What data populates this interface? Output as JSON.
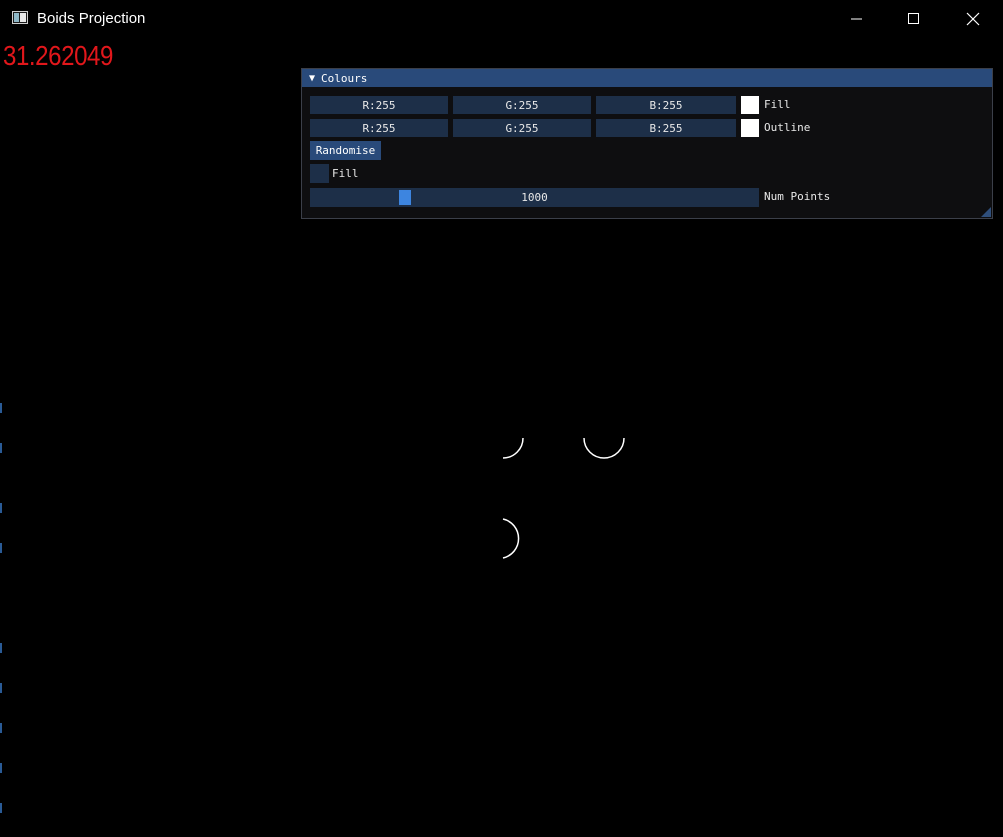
{
  "window": {
    "title": "Boids Projection",
    "icons": {
      "app": "app-window-icon",
      "minimize": "minimize-icon",
      "maximize": "maximize-icon",
      "close": "close-icon"
    }
  },
  "overlay": {
    "fps_value": "31.262049",
    "fps_color": "#e1171b"
  },
  "colours_panel": {
    "title": "Colours",
    "fill_color": {
      "r": "R:255",
      "g": "G:255",
      "b": "B:255",
      "label": "Fill",
      "swatch": "#ffffff"
    },
    "outline_color": {
      "r": "R:255",
      "g": "G:255",
      "b": "B:255",
      "label": "Outline",
      "swatch": "#ffffff"
    },
    "randomise_label": "Randomise",
    "fill_toggle": {
      "label": "Fill",
      "checked": false
    },
    "num_points": {
      "value": "1000",
      "label": "Num Points",
      "fraction": 0.2
    }
  },
  "colors": {
    "accent": "#294a7a",
    "frame": "#1d2f48",
    "slider_grab": "#3d85e0",
    "background": "#000000"
  }
}
